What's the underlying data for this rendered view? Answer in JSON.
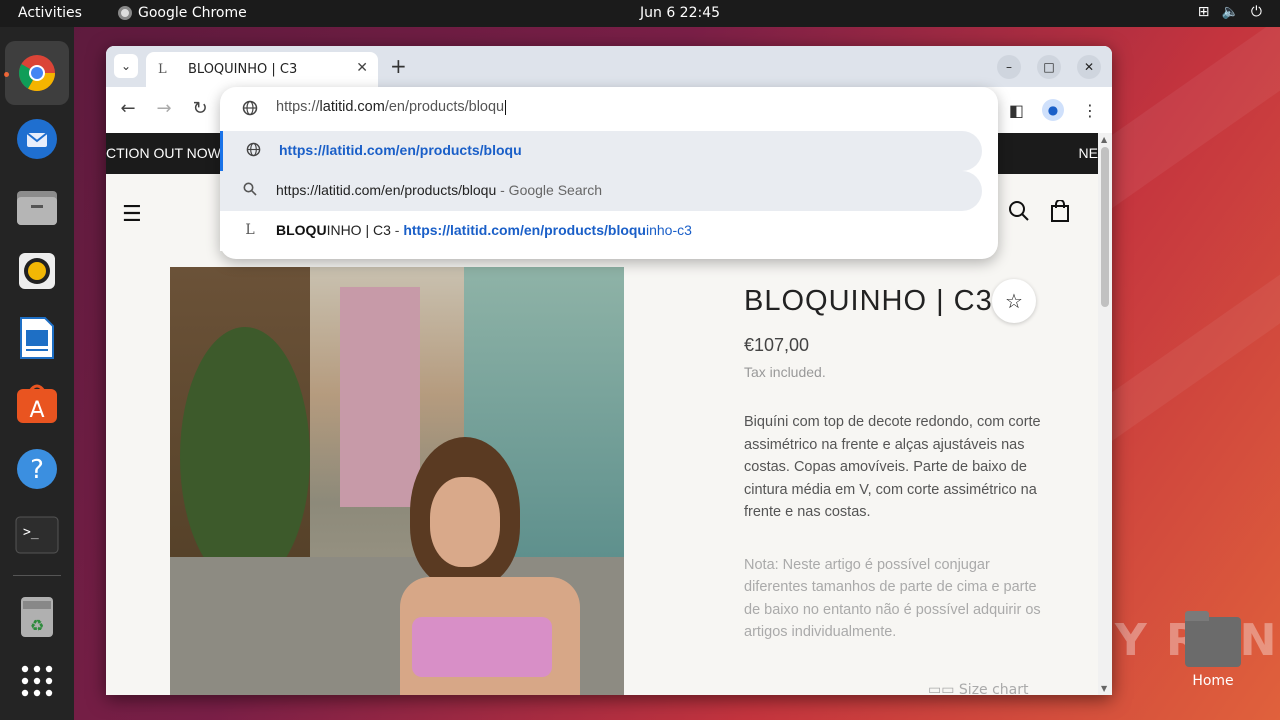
{
  "topbar": {
    "activities": "Activities",
    "app_name": "Google Chrome",
    "clock": "Jun 6  22:45"
  },
  "dock": {
    "items": [
      "chrome-icon",
      "thunderbird-icon",
      "files-icon",
      "rhythmbox-icon",
      "writer-icon",
      "app-center-icon",
      "help-icon",
      "terminal-icon",
      "trash-icon",
      "app-grid-icon"
    ]
  },
  "desktop": {
    "home_label": "Home",
    "watermark": "ANY RUN"
  },
  "browser": {
    "tab_title": "BLOQUINHO | C3",
    "tab_favicon": "L",
    "omnibox": {
      "prefix": "https://",
      "host": "latitid.com",
      "path": "/en/products/bloqu",
      "suggestions": [
        {
          "icon": "globe-icon",
          "text": "https://latitid.com/en/products/bloqu"
        },
        {
          "icon": "search-icon",
          "text": "https://latitid.com/en/products/bloqu",
          "suffix": " - Google Search"
        },
        {
          "icon": "favicon-L",
          "title_bold": "BLOQU",
          "title_rest": "INHO | C3",
          "sep": " - ",
          "url_bold": "https://latitid.com/en/products/bloqu",
          "url_rest": "inho-c3"
        }
      ]
    }
  },
  "page": {
    "announce_left": "CTION OUT NOW",
    "announce_right": "NE",
    "product": {
      "title": "BLOQUINHO | C3",
      "price": "€107,00",
      "tax": "Tax included.",
      "description": "Biquíni com top de decote redondo, com corte assimétrico na frente e alças ajustáveis nas costas. Copas amovíveis. Parte de baixo de cintura média em V, com corte assimétrico na frente e nas costas.",
      "note": "Nota: Neste artigo é possível conjugar diferentes tamanhos de parte de cima e parte de baixo no entanto não é possível adquirir os artigos individualmente.",
      "size_chart": "Size chart"
    }
  },
  "colors": {
    "accent": "#1a73e8",
    "link": "#1a5fc8",
    "ubuntu_orange": "#e95420"
  }
}
